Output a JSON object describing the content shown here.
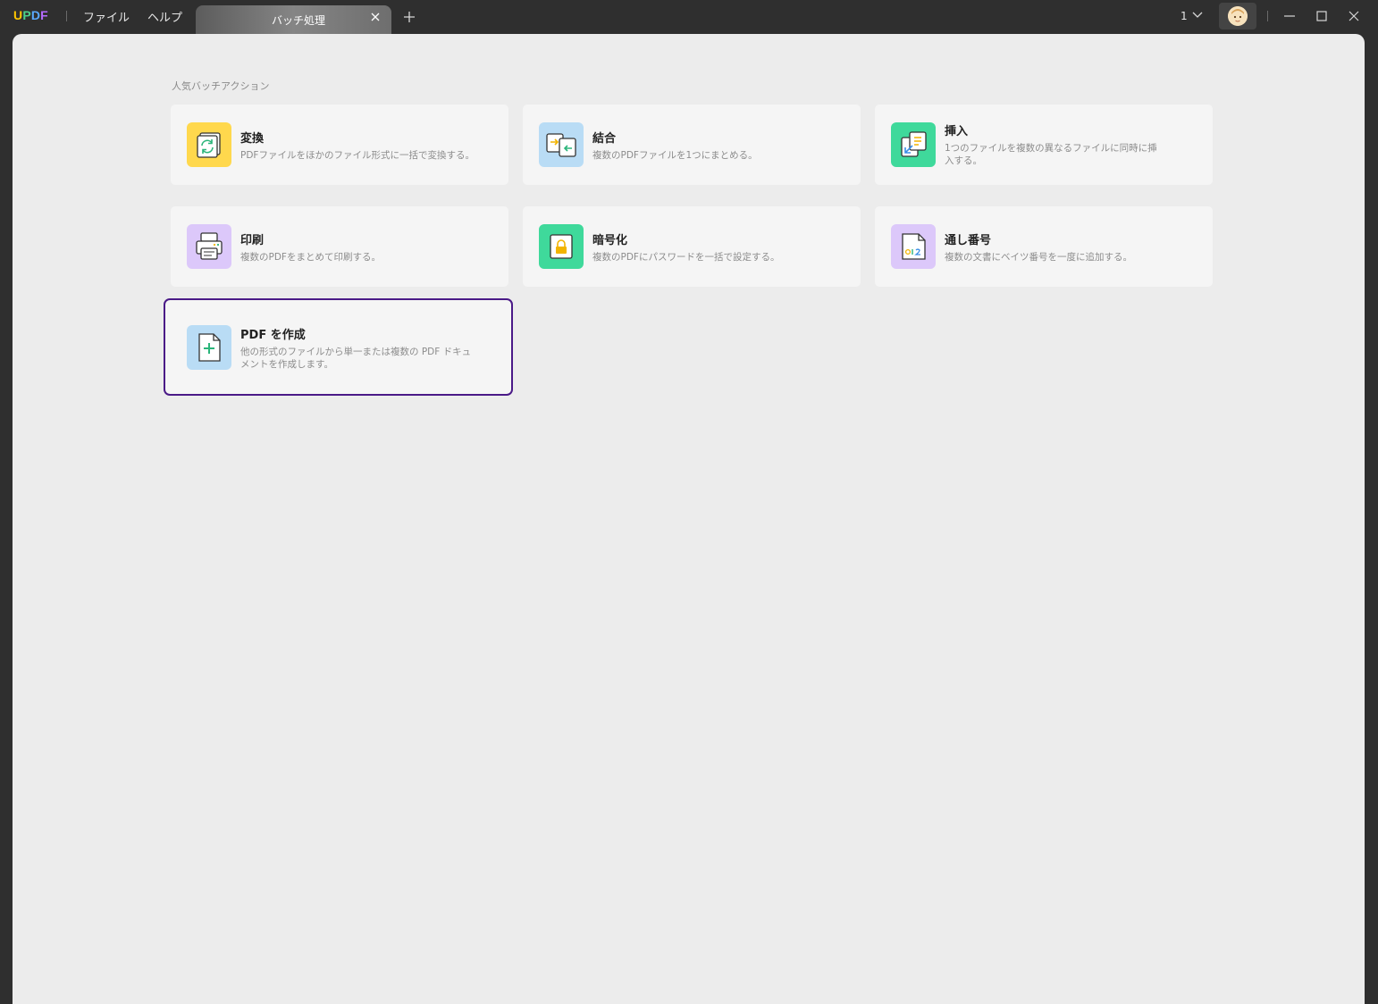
{
  "app": {
    "logo": {
      "u": "U",
      "p": "P",
      "d": "D",
      "f": "F"
    },
    "menu": {
      "file": "ファイル",
      "help": "ヘルプ"
    },
    "tab": {
      "label": "バッチ処理"
    },
    "page_count": "1",
    "colors": {
      "selected_outline": "#4a1a87",
      "panel_bg": "#ececec",
      "titlebar_bg": "#2f2f2f"
    }
  },
  "main": {
    "section_title": "人気バッチアクション",
    "cards": [
      {
        "title": "変換",
        "desc": "PDFファイルをほかのファイル形式に一括で変換する。",
        "icon": "convert-icon",
        "color": "#ffd84d"
      },
      {
        "title": "結合",
        "desc": "複数のPDFファイルを1つにまとめる。",
        "icon": "combine-icon",
        "color": "#b9dcf5"
      },
      {
        "title": "挿入",
        "desc": "1つのファイルを複数の異なるファイルに同時に挿入する。",
        "icon": "insert-icon",
        "color": "#3fd99b"
      },
      {
        "title": "印刷",
        "desc": "複数のPDFをまとめて印刷する。",
        "icon": "print-icon",
        "color": "#dcc8fa"
      },
      {
        "title": "暗号化",
        "desc": "複数のPDFにパスワードを一括で設定する。",
        "icon": "lock-icon",
        "color": "#3fd99b"
      },
      {
        "title": "通し番号",
        "desc": "複数の文書にベイツ番号を一度に追加する。",
        "icon": "bates-number-icon",
        "color": "#dcc8fa"
      },
      {
        "title": "PDF を作成",
        "desc": "他の形式のファイルから単一または複数の PDF ドキュメントを作成します。",
        "icon": "create-pdf-icon",
        "color": "#b9dcf5"
      }
    ]
  }
}
